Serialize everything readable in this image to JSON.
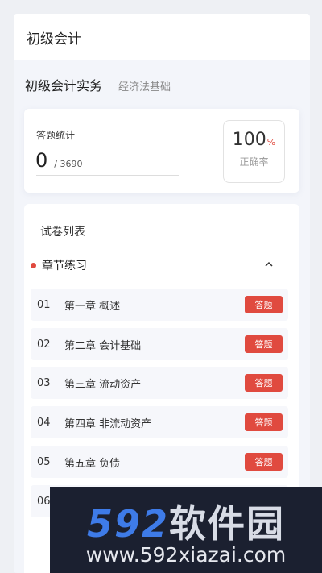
{
  "header": {
    "title": "初级会计"
  },
  "subjects": {
    "active": "初级会计实务",
    "other": "经济法基础"
  },
  "stats": {
    "label": "答题统计",
    "answered": "0",
    "total": "/ 3690",
    "rate_value": "100",
    "rate_unit": "%",
    "rate_label": "正确率"
  },
  "paper_list": {
    "title": "试卷列表",
    "section_label": "章节练习",
    "chapters": [
      {
        "num": "01",
        "name": "第一章 概述",
        "button": "答题"
      },
      {
        "num": "02",
        "name": "第二章 会计基础",
        "button": "答题"
      },
      {
        "num": "03",
        "name": "第三章 流动资产",
        "button": "答题"
      },
      {
        "num": "04",
        "name": "第四章 非流动资产",
        "button": "答题"
      },
      {
        "num": "05",
        "name": "第五章 负债",
        "button": "答题"
      },
      {
        "num": "06",
        "name": "",
        "button": ""
      }
    ]
  },
  "watermark": {
    "brand_num": "592",
    "brand_cn": "软件园",
    "url": "www.592xiazai.com"
  },
  "colors": {
    "accent": "#e04a3f",
    "background": "#f3f5fa"
  }
}
